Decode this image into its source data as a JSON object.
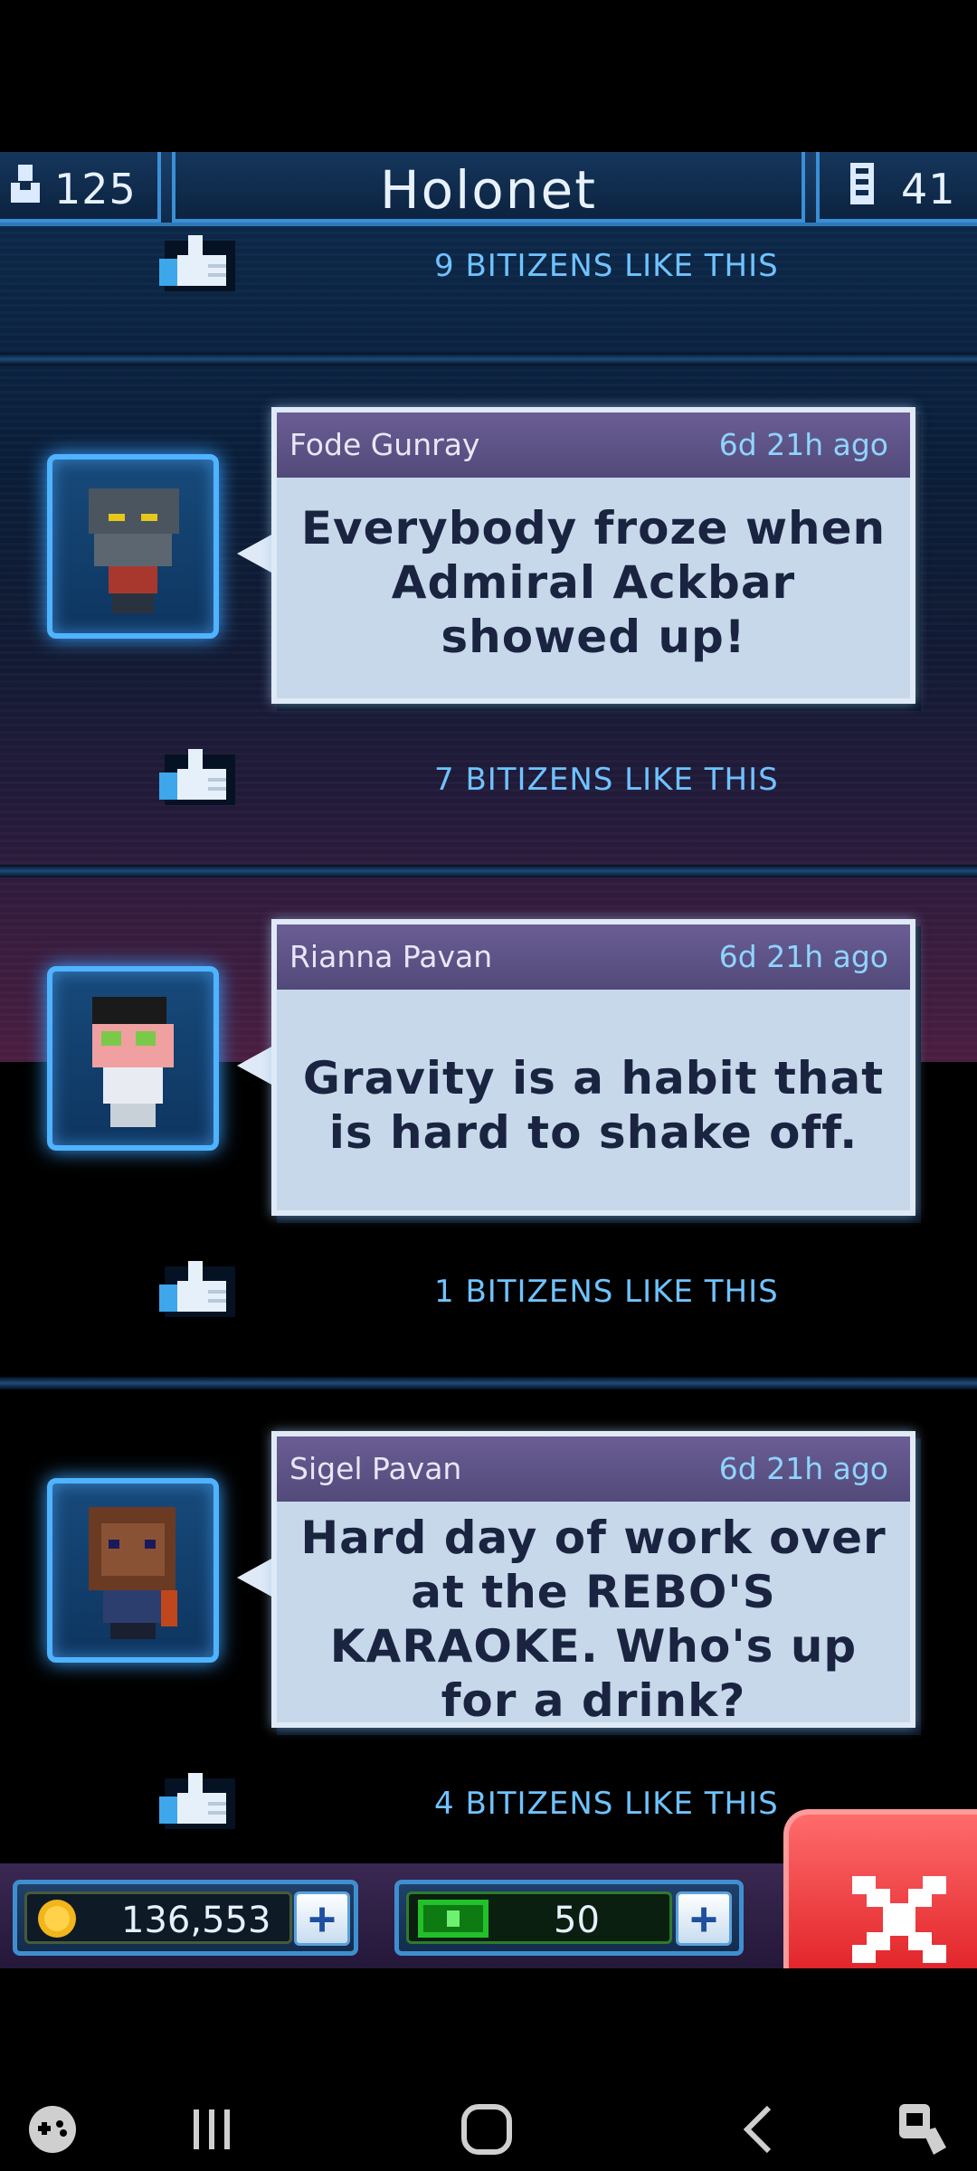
{
  "header": {
    "population": "125",
    "title": "Holonet",
    "floors": "41"
  },
  "top_likes": "9 BITIZENS LIKE THIS",
  "posts": [
    {
      "author": "Fode Gunray",
      "time": "6d 21h ago",
      "message": "Everybody froze when Admiral Ackbar showed up!",
      "likes": "7 BITIZENS LIKE THIS"
    },
    {
      "author": "Rianna Pavan",
      "time": "6d 21h ago",
      "message": "Gravity is a habit that is hard to shake off.",
      "likes": "1 BITIZENS LIKE THIS"
    },
    {
      "author": "Sigel Pavan",
      "time": "6d 21h ago",
      "message": "Hard day of work over at the REBO'S KARAOKE. Who's up for a drink?",
      "likes": "4 BITIZENS LIKE THIS"
    }
  ],
  "resources": {
    "coins": "136,553",
    "bux": "50"
  },
  "colors": {
    "accent_blue": "#4fb3ff",
    "like_text": "#6fc3ff",
    "close_red": "#e2262b"
  }
}
